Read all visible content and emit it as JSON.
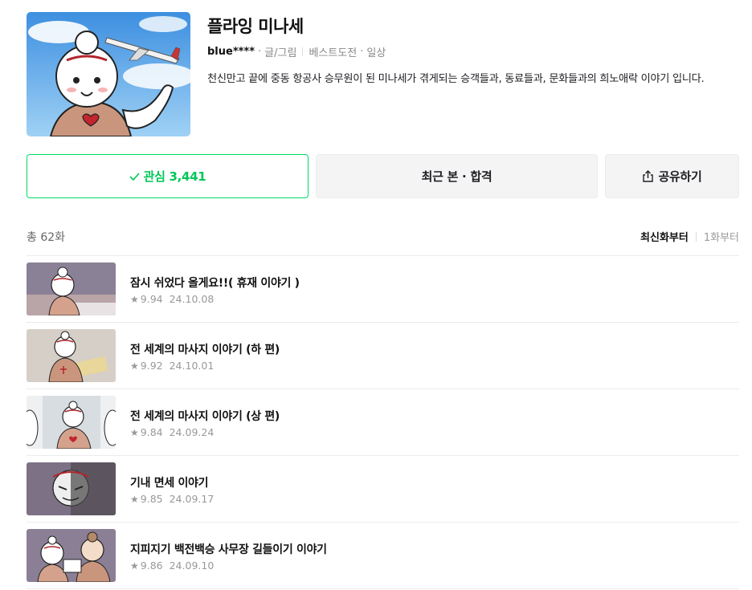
{
  "series": {
    "title": "플라잉 미나세",
    "author": "blue****",
    "role": "글/그림",
    "badges": [
      "베스트도전",
      "일상"
    ],
    "description": "천신만고 끝에 중동 항공사 승무원이 된 미나세가 겪게되는 승객들과, 동료들과, 문화들과의 희노애락 이야기 입니다."
  },
  "actions": {
    "favorite_label": "관심 3,441",
    "recent_label": "최근 본 · 합격",
    "share_label": "공유하기"
  },
  "list_header": {
    "total": "총 62화",
    "sort_newest": "최신화부터",
    "sort_first": "1화부터"
  },
  "episodes": [
    {
      "title": "잠시 쉬었다 올게요!!( 휴재 이야기 )",
      "rating": "9.94",
      "date": "24.10.08"
    },
    {
      "title": "전 세계의 마사지 이야기 (하 편)",
      "rating": "9.92",
      "date": "24.10.01"
    },
    {
      "title": "전 세계의 마사지 이야기 (상 편)",
      "rating": "9.84",
      "date": "24.09.24"
    },
    {
      "title": "기내 면세 이야기",
      "rating": "9.85",
      "date": "24.09.17"
    },
    {
      "title": "지피지기 백전백승 사무장 길들이기 이야기",
      "rating": "9.86",
      "date": "24.09.10"
    }
  ],
  "colors": {
    "accent_green": "#00dc64",
    "text_dark": "#111111",
    "text_muted": "#999999"
  },
  "icons": {
    "favorite": "check-icon",
    "share": "share-icon",
    "rating": "star-icon"
  }
}
